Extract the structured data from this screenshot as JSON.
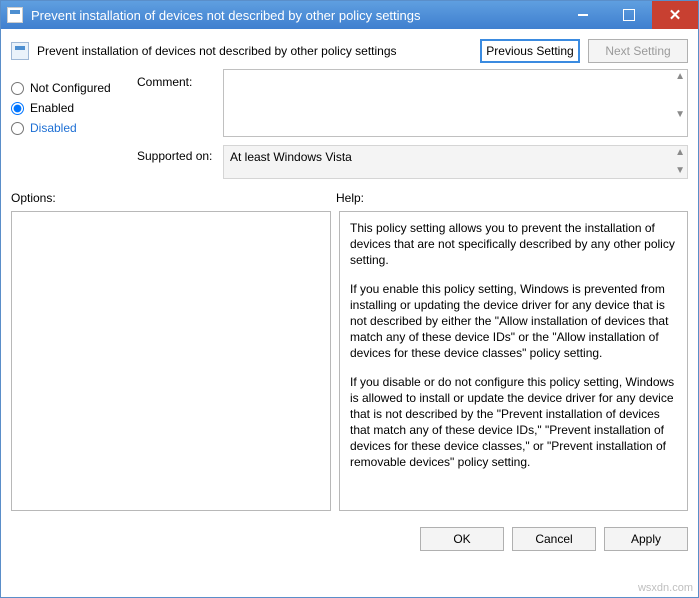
{
  "window": {
    "title": "Prevent installation of devices not described by other policy settings"
  },
  "header": {
    "policy_name": "Prevent installation of devices not described by other policy settings",
    "prev_button": "Previous Setting",
    "next_button": "Next Setting"
  },
  "radios": {
    "not_configured": "Not Configured",
    "enabled": "Enabled",
    "disabled": "Disabled",
    "selected": "enabled"
  },
  "labels": {
    "comment": "Comment:",
    "supported_on": "Supported on:",
    "options": "Options:",
    "help": "Help:"
  },
  "fields": {
    "comment_value": "",
    "supported_on_value": "At least Windows Vista"
  },
  "help": {
    "p1": "This policy setting allows you to prevent the installation of devices that are not specifically described by any other policy setting.",
    "p2": "If you enable this policy setting, Windows is prevented from installing or updating the device driver for any device that is not described by either the \"Allow installation of devices that match any of these device IDs\" or the \"Allow installation of devices for these device classes\" policy setting.",
    "p3": "If you disable or do not configure this policy setting, Windows is allowed to install or update the device driver for any device that is not described by the \"Prevent installation of devices that match any of these device IDs,\" \"Prevent installation of devices for these device classes,\" or \"Prevent installation of removable devices\" policy setting."
  },
  "footer": {
    "ok": "OK",
    "cancel": "Cancel",
    "apply": "Apply"
  },
  "watermark": "wsxdn.com"
}
